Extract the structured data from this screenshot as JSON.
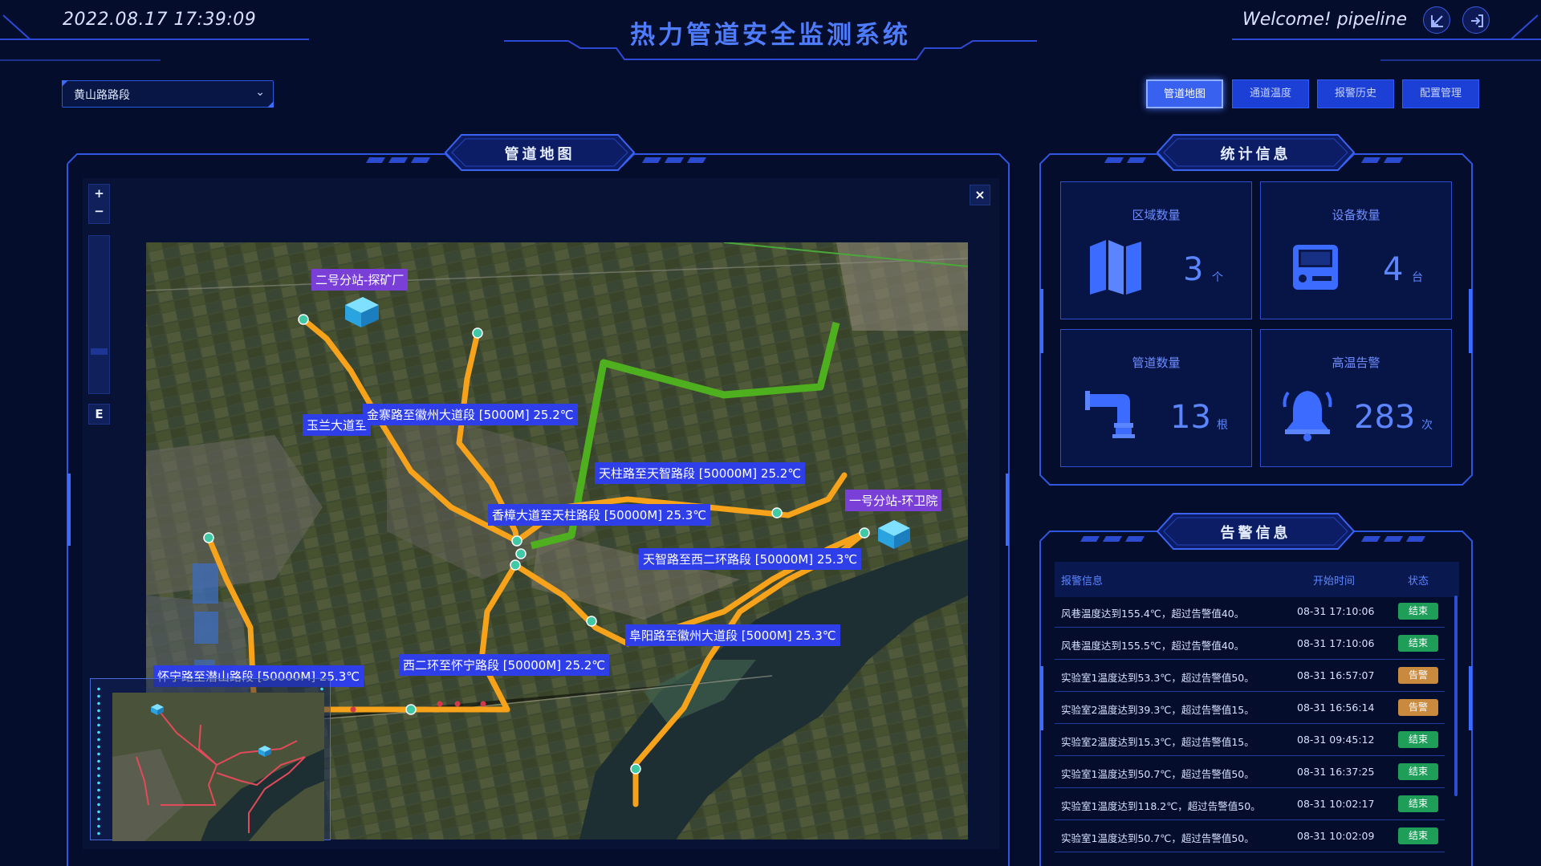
{
  "header": {
    "datetime": "2022.08.17 17:39:09",
    "title": "热力管道安全监测系统",
    "welcome": "Welcome! pipeline",
    "icons": [
      "collapse-icon",
      "logout-icon"
    ]
  },
  "section_select": {
    "value": "黄山路路段"
  },
  "nav": {
    "items": [
      {
        "label": "管道地图",
        "active": true
      },
      {
        "label": "通道温度",
        "active": false
      },
      {
        "label": "报警历史",
        "active": false
      },
      {
        "label": "配置管理",
        "active": false
      }
    ]
  },
  "map_panel": {
    "title": "管道地图",
    "controls": {
      "zoom_in": "+",
      "zoom_out": "−",
      "orient": "E",
      "close": "×"
    },
    "stations": [
      "二号分站-探矿厂",
      "一号分站-环卫院"
    ],
    "segments": [
      "金寨路至徽州大道段 [5000M] 25.2℃",
      "玉兰大道至",
      "天柱路至天智路段 [50000M] 25.2℃",
      "香樟大道至天柱路段 [50000M] 25.3℃",
      "天智路至西二环路段 [50000M] 25.3℃",
      "阜阳路至徽州大道段 [5000M] 25.3℃",
      "西二环至怀宁路段 [50000M] 25.2℃",
      "怀宁路至潜山路段 [50000M] 25.3℃"
    ]
  },
  "stats_panel": {
    "title": "统计信息",
    "cards": [
      {
        "label": "区域数量",
        "value": "3",
        "unit": "个",
        "icon": "map-icon"
      },
      {
        "label": "设备数量",
        "value": "4",
        "unit": "台",
        "icon": "device-icon"
      },
      {
        "label": "管道数量",
        "value": "13",
        "unit": "根",
        "icon": "pipe-icon"
      },
      {
        "label": "高温告警",
        "value": "283",
        "unit": "次",
        "icon": "bell-icon"
      }
    ]
  },
  "alarm_panel": {
    "title": "告警信息",
    "columns": [
      "报警信息",
      "开始时间",
      "状态"
    ],
    "status_colors": {
      "结束": "#1f9e5a",
      "告警": "#c98a3e"
    },
    "rows": [
      {
        "msg": "风巷温度达到155.4℃，超过告警值40。",
        "time": "08-31 17:10:06",
        "status": "结束"
      },
      {
        "msg": "风巷温度达到155.5℃，超过告警值40。",
        "time": "08-31 17:10:06",
        "status": "结束"
      },
      {
        "msg": "实验室1温度达到53.3℃，超过告警值50。",
        "time": "08-31 16:57:07",
        "status": "告警"
      },
      {
        "msg": "实验室2温度达到39.3℃，超过告警值15。",
        "time": "08-31 16:56:14",
        "status": "告警"
      },
      {
        "msg": "实验室2温度达到15.3℃，超过告警值15。",
        "time": "08-31 09:45:12",
        "status": "结束"
      },
      {
        "msg": "实验室1温度达到50.7℃，超过告警值50。",
        "time": "08-31 16:37:25",
        "status": "结束"
      },
      {
        "msg": "实验室1温度达到118.2℃，超过告警值50。",
        "time": "08-31 10:02:17",
        "status": "结束"
      },
      {
        "msg": "实验室1温度达到50.7℃，超过告警值50。",
        "time": "08-31 10:02:09",
        "status": "结束"
      }
    ]
  },
  "colors": {
    "accent": "#2f5cff",
    "pipe_orange": "#f7a21b",
    "pipe_green": "#4aa81c",
    "node": "#3fc9a4"
  }
}
